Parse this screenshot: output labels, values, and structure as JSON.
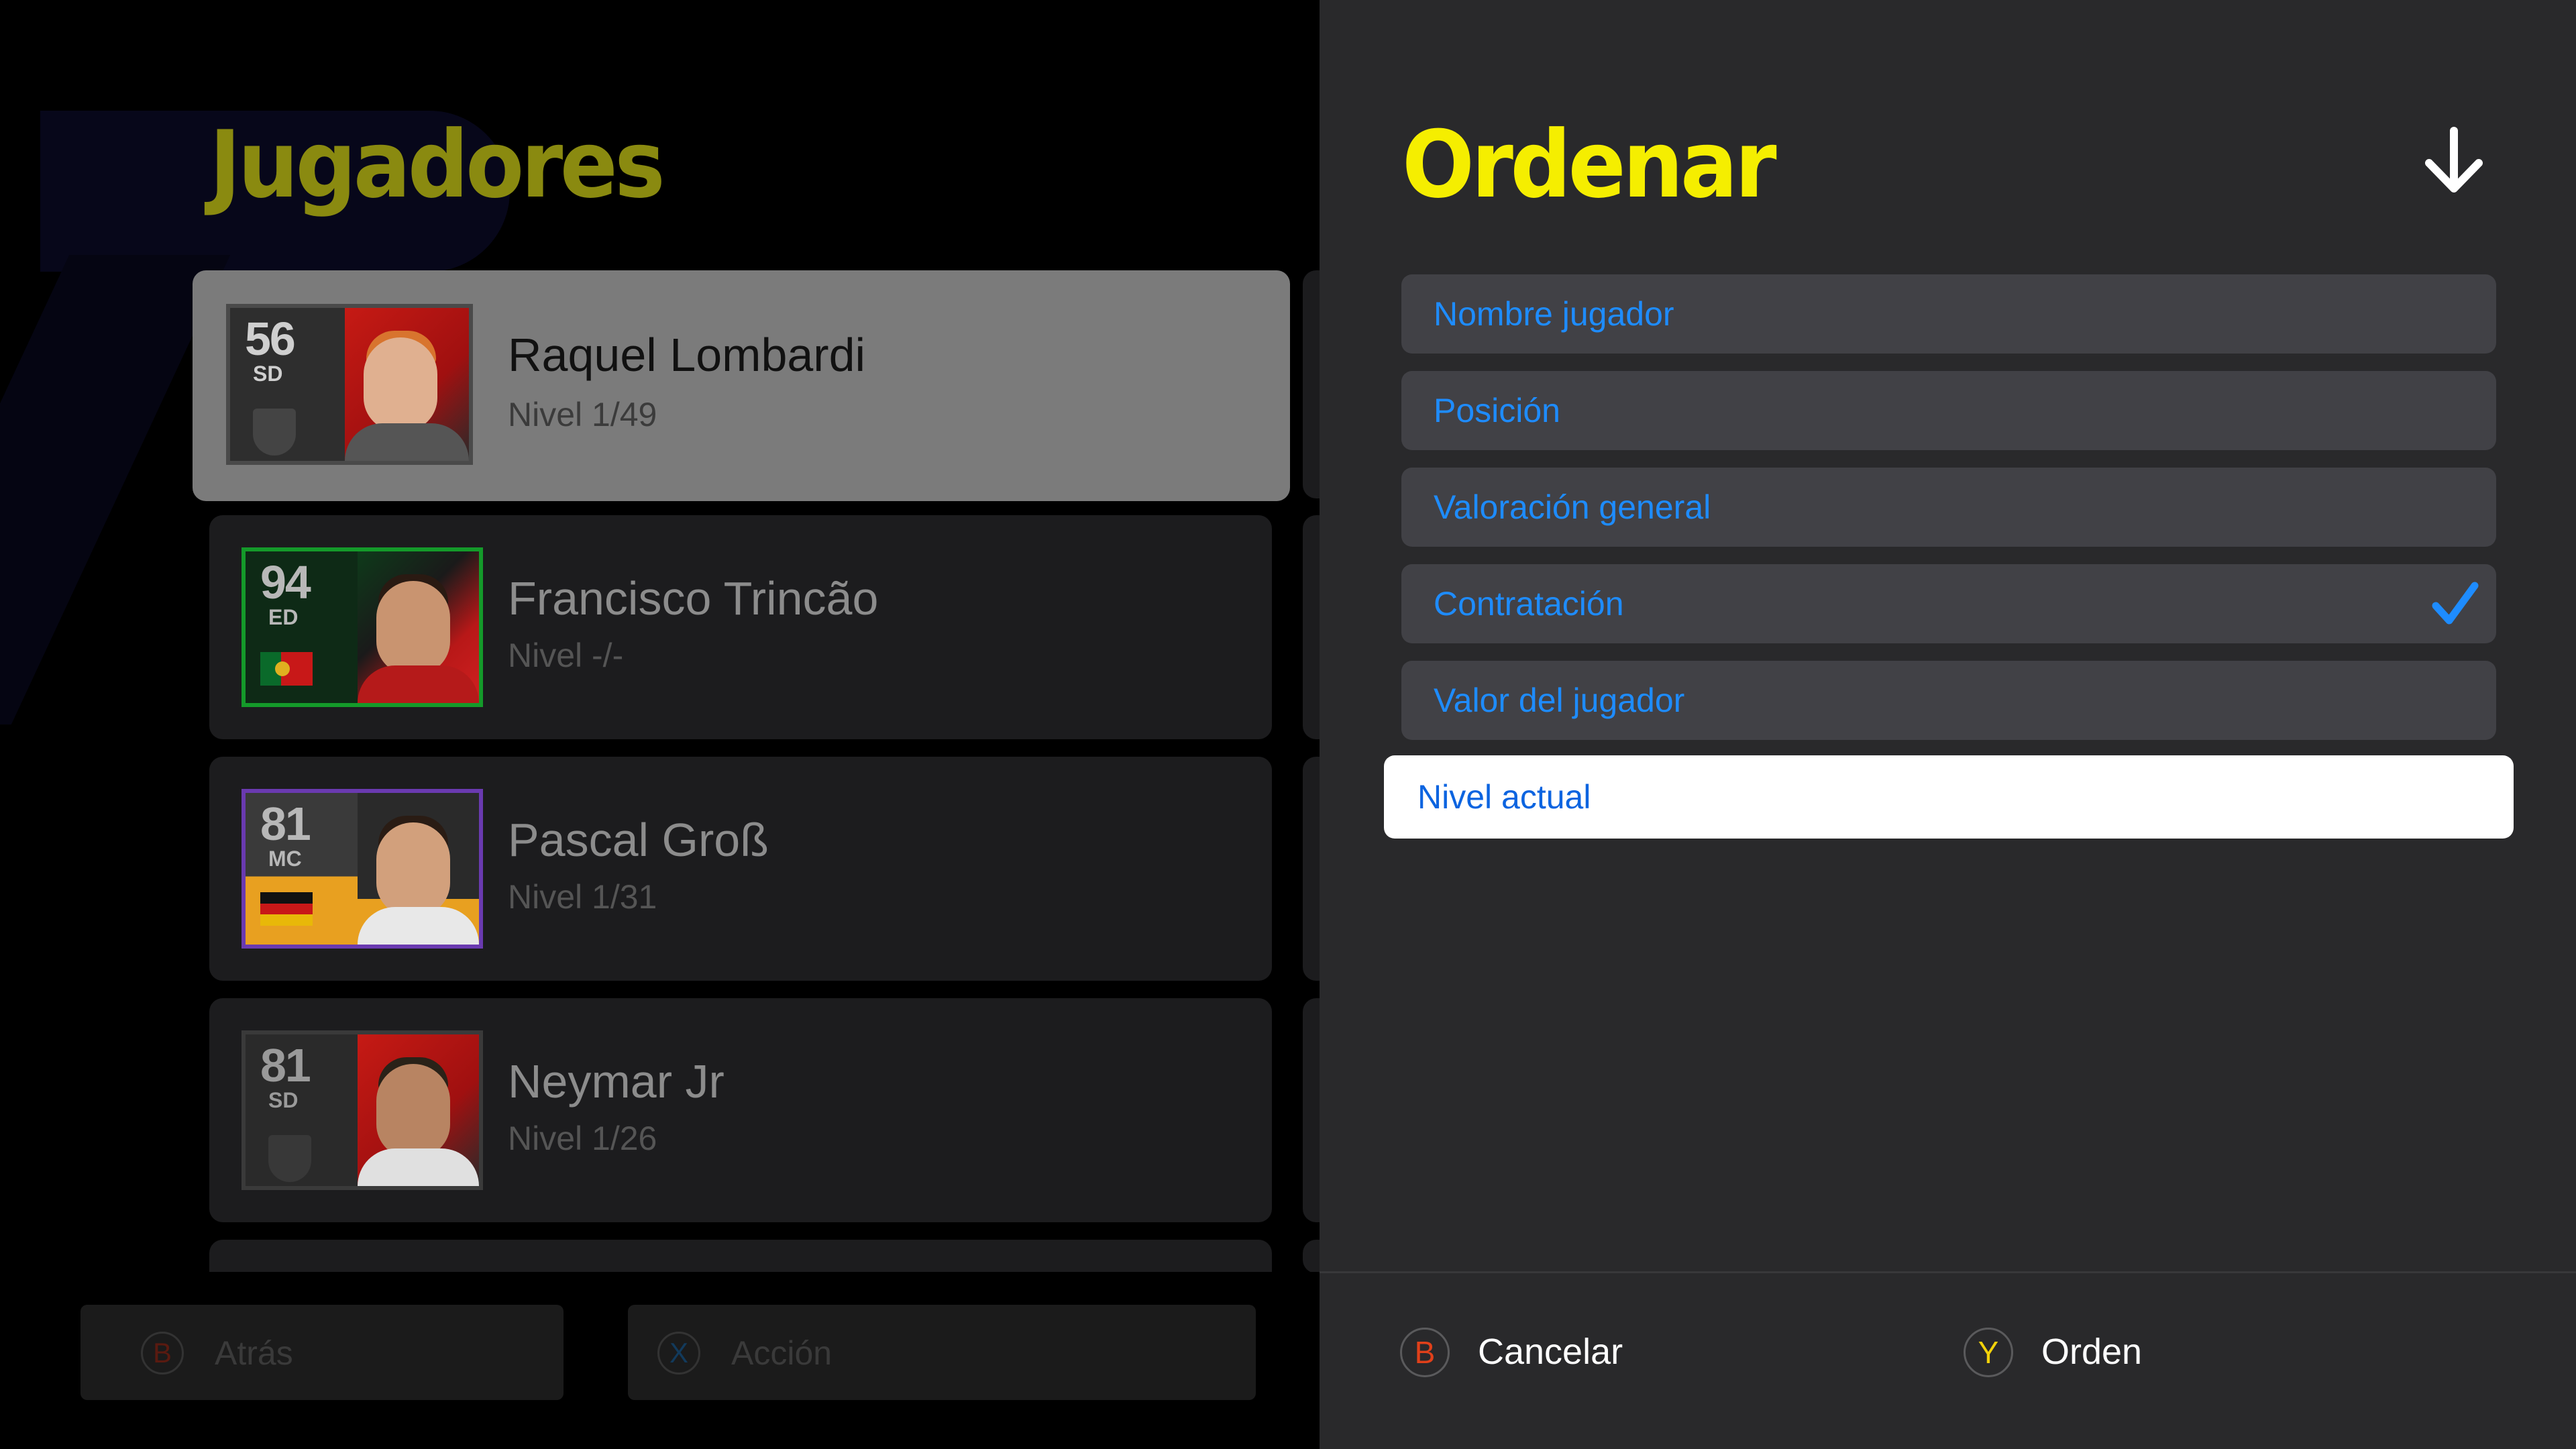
{
  "left": {
    "title": "Jugadores",
    "players": [
      {
        "name": "Raquel Lombardi",
        "level": "Nivel 1/49",
        "rating": "56",
        "position": "SD",
        "selected": true
      },
      {
        "name": "Francisco Trincão",
        "level": "Nivel -/-",
        "rating": "94",
        "position": "ED",
        "selected": false
      },
      {
        "name": "Pascal Groß",
        "level": "Nivel 1/31",
        "rating": "81",
        "position": "MC",
        "selected": false
      },
      {
        "name": "Neymar Jr",
        "level": "Nivel 1/26",
        "rating": "81",
        "position": "SD",
        "selected": false
      }
    ],
    "buttons": {
      "back": {
        "key": "B",
        "label": "Atrás"
      },
      "action": {
        "key": "X",
        "label": "Acción"
      }
    }
  },
  "panel": {
    "title": "Ordenar",
    "sort_direction_icon": "arrow-down-icon",
    "options": [
      {
        "label": "Nombre jugador",
        "checked": false,
        "focused": false
      },
      {
        "label": "Posición",
        "checked": false,
        "focused": false
      },
      {
        "label": "Valoración general",
        "checked": false,
        "focused": false
      },
      {
        "label": "Contratación",
        "checked": true,
        "focused": false
      },
      {
        "label": "Valor del jugador",
        "checked": false,
        "focused": false
      },
      {
        "label": "Nivel actual",
        "checked": false,
        "focused": true
      }
    ],
    "buttons": {
      "cancel": {
        "key": "B",
        "label": "Cancelar"
      },
      "order": {
        "key": "Y",
        "label": "Orden"
      }
    }
  },
  "colors": {
    "accent_yellow": "#f5ee00",
    "option_blue": "#1e8cff",
    "check_blue": "#1e8cff",
    "panel_bg": "#29292b",
    "key_b": "#e0401a",
    "key_y": "#f2d20a",
    "key_x": "#1a78c8"
  }
}
